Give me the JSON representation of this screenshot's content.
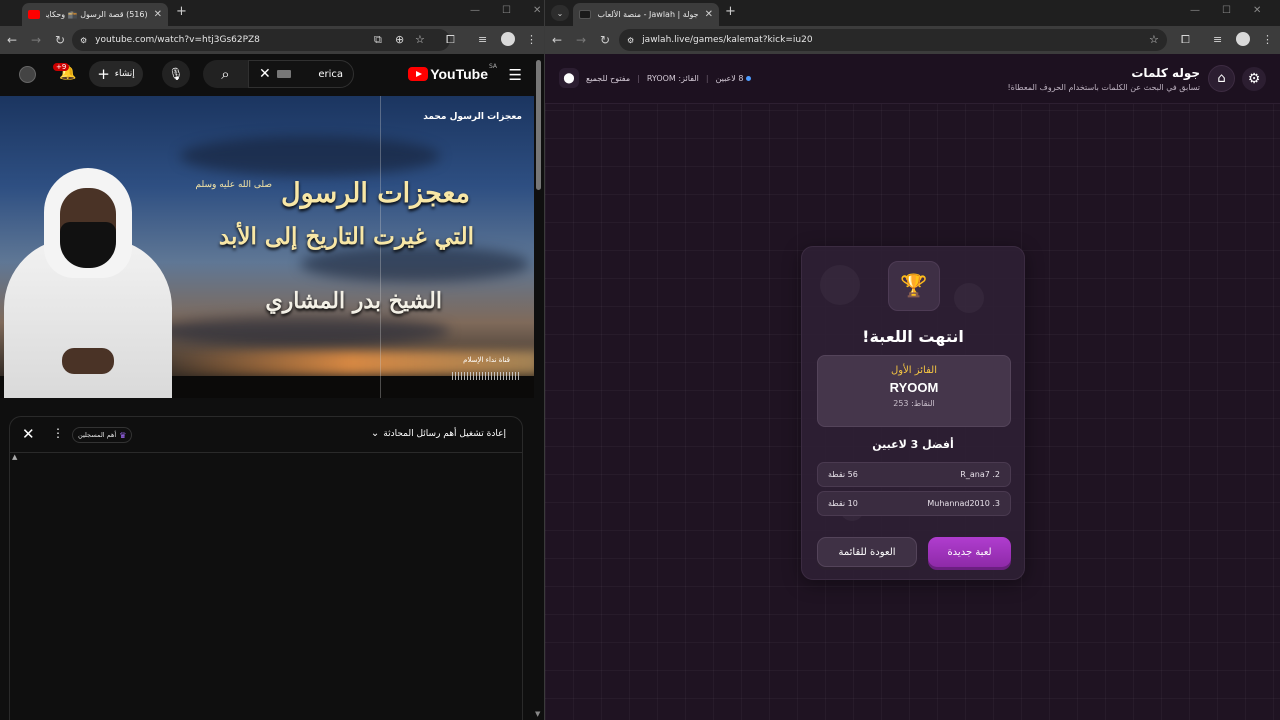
{
  "left_window": {
    "tab": {
      "title": "(516) قصة الرسول 🕋 وحكاية",
      "close": "✕"
    },
    "new_tab": "+",
    "window_controls": [
      "—",
      "☐",
      "✕"
    ],
    "url": "youtube.com/watch?v=htj3Gs62PZ8",
    "youtube": {
      "logo_text": "YouTube",
      "country": "SA",
      "search_value": "erica",
      "create_label": "إنشاء",
      "notifications_badge": "+9"
    },
    "video": {
      "channel_top": "معجزات الرسول محمد",
      "title_line1": "معجزات الرسول",
      "pbuh": "صلى الله عليه وسلم",
      "title_line2": "التي غيرت التاريخ إلى الأبد",
      "title_line3": "الشيخ بدر المشاري",
      "channel_bottom": "قناة نداء الإسلام"
    },
    "chat": {
      "title": "إعادة تشغيل أهم رسائل المحادثة",
      "members_pill": "أهم المسجلين"
    }
  },
  "right_window": {
    "tab": {
      "title": "جولة | Jawlah - منصة الألعاب الذ...",
      "close": "✕"
    },
    "new_tab": "+",
    "window_controls": [
      "—",
      "☐",
      "✕"
    ],
    "url": "jawlah.live/games/kalemat?kick=iu20",
    "header": {
      "title": "جوله كلمات",
      "subtitle": "تسابق في البحث عن الكلمات باستخدام الحروف المعطاة!",
      "players": "8 لاعبين",
      "winner_label": "الفائز: RYOOM",
      "open_label": "مفتوح للجميع"
    },
    "result": {
      "heading": "انتهت اللعبة!",
      "first_label": "الفائز الأول",
      "winner_name": "RYOOM",
      "winner_points": "النقاط: 253",
      "top3_heading": "أفضل 3 لاعبين",
      "rows": [
        {
          "rank_name": "2. R_ana7",
          "points": "56 نقطة"
        },
        {
          "rank_name": "3. Muhannad2010",
          "points": "10 نقطة"
        }
      ],
      "new_game_label": "لعبة جديدة",
      "back_label": "العودة للقائمة"
    }
  },
  "colors": {
    "youtube_red": "#ff0000",
    "jawlah_purple": "#b03dcf",
    "winner_gold": "#f5c542",
    "status_blue": "#4d9cff"
  }
}
